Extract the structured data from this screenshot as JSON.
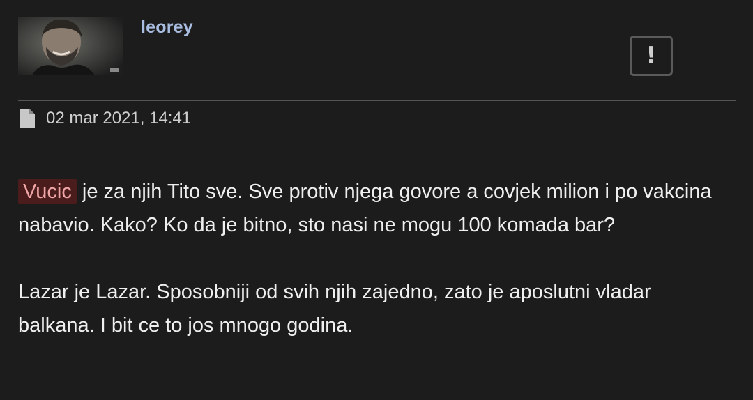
{
  "post": {
    "author": "leorey",
    "report_label": "!",
    "date": "02 mar 2021, 14:41",
    "paragraph1": {
      "mention": "Vucic",
      "text": " je za njih Tito sve. Sve protiv njega govore a covjek milion i po vakcina nabavio. Kako? Ko da je bitno, sto nasi ne mogu 100 komada bar?"
    },
    "paragraph2": "Lazar je Lazar. Sposobniji od svih njih zajedno, zato je aposlutni vladar balkana. I bit ce to jos mnogo godina."
  },
  "icons": {
    "report": "exclamation-icon",
    "post_date": "file-icon"
  },
  "colors": {
    "background": "#1c1c1d",
    "username": "#a9bde0",
    "mention_bg": "#4a1c1c",
    "mention_text": "#f0a6a6"
  }
}
